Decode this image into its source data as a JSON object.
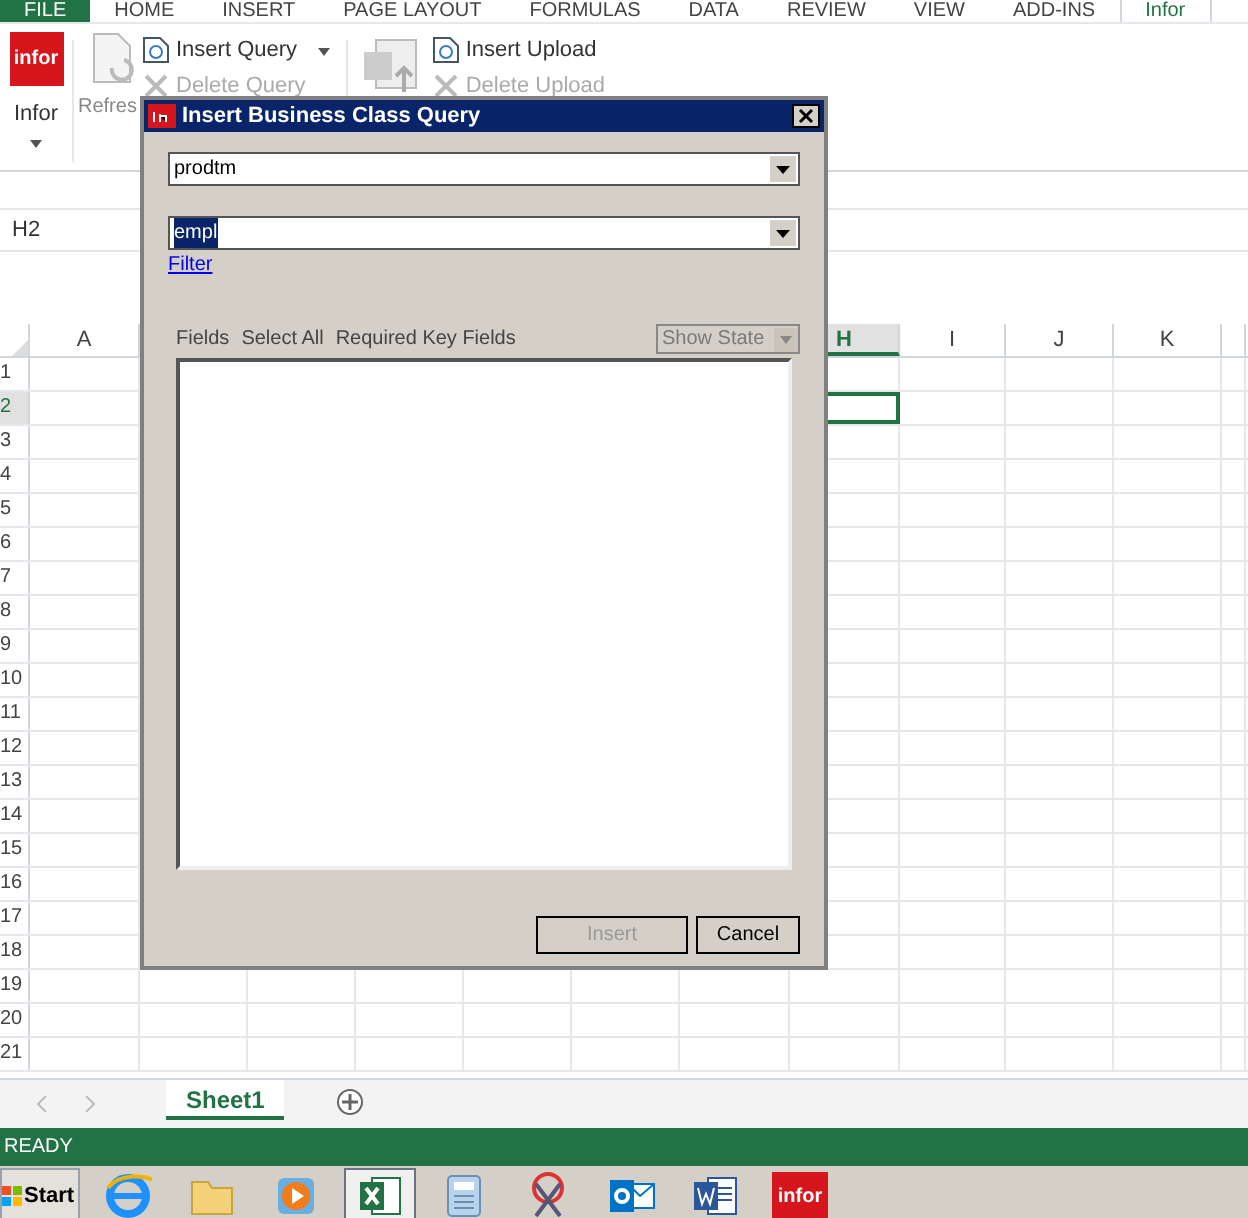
{
  "ribbon_tabs": [
    {
      "label": "FILE",
      "kind": "file",
      "selected": false
    },
    {
      "label": "HOME",
      "selected": false
    },
    {
      "label": "INSERT",
      "selected": false
    },
    {
      "label": "PAGE LAYOUT",
      "selected": false
    },
    {
      "label": "FORMULAS",
      "selected": false
    },
    {
      "label": "DATA",
      "selected": false
    },
    {
      "label": "REVIEW",
      "selected": false
    },
    {
      "label": "VIEW",
      "selected": false
    },
    {
      "label": "ADD-INS",
      "selected": false
    },
    {
      "label": "Infor",
      "selected": true
    }
  ],
  "ribbon": {
    "infor_logo": "infor",
    "infor_label": "Infor",
    "refresh_label": "Refres",
    "insert_query": "Insert Query",
    "delete_query": {
      "label": "Delete Query",
      "disabled": true
    },
    "insert_upload": "Insert Upload",
    "delete_upload": {
      "label": "Delete Upload",
      "disabled": true
    }
  },
  "name_box": "H2",
  "columns": [
    {
      "label": "A",
      "selected": false
    },
    {
      "label": "H",
      "selected": true
    },
    {
      "label": "I",
      "selected": false
    },
    {
      "label": "J",
      "selected": false
    },
    {
      "label": "K",
      "selected": false
    }
  ],
  "rows": [
    {
      "label": "1",
      "selected": false
    },
    {
      "label": "2",
      "selected": true
    },
    {
      "label": "3",
      "selected": false
    },
    {
      "label": "4",
      "selected": false
    },
    {
      "label": "5",
      "selected": false
    },
    {
      "label": "6",
      "selected": false
    },
    {
      "label": "7",
      "selected": false
    },
    {
      "label": "8",
      "selected": false
    },
    {
      "label": "9",
      "selected": false
    },
    {
      "label": "10",
      "selected": false
    },
    {
      "label": "11",
      "selected": false
    },
    {
      "label": "12",
      "selected": false
    },
    {
      "label": "13",
      "selected": false
    },
    {
      "label": "14",
      "selected": false
    },
    {
      "label": "15",
      "selected": false
    },
    {
      "label": "16",
      "selected": false
    },
    {
      "label": "17",
      "selected": false
    },
    {
      "label": "18",
      "selected": false
    },
    {
      "label": "19",
      "selected": false
    },
    {
      "label": "20",
      "selected": false
    },
    {
      "label": "21",
      "selected": false
    }
  ],
  "sheet_tabs": [
    {
      "label": "Sheet1",
      "selected": true
    }
  ],
  "status_bar": "READY",
  "dialog": {
    "title": "Insert Business Class Query",
    "product_line": "prodtm",
    "business_class": "empl",
    "filter_link": "Filter",
    "field_tabs": [
      "Fields",
      "Select All",
      "Required Key Fields"
    ],
    "show_state": {
      "label": "Show State",
      "disabled": true
    },
    "buttons": [
      {
        "label": "Insert",
        "disabled": true
      },
      {
        "label": "Cancel",
        "disabled": false
      }
    ]
  },
  "taskbar": {
    "start": "Start",
    "apps": [
      {
        "kind": "browser",
        "selected": false
      },
      {
        "kind": "folder",
        "selected": false
      },
      {
        "kind": "media",
        "selected": false
      },
      {
        "kind": "excel",
        "selected": true
      },
      {
        "kind": "calculator",
        "selected": false
      },
      {
        "kind": "scissors",
        "selected": false
      },
      {
        "kind": "outlook",
        "selected": false
      },
      {
        "kind": "word",
        "selected": false
      },
      {
        "kind": "infor",
        "selected": false,
        "label": "infor"
      }
    ]
  }
}
